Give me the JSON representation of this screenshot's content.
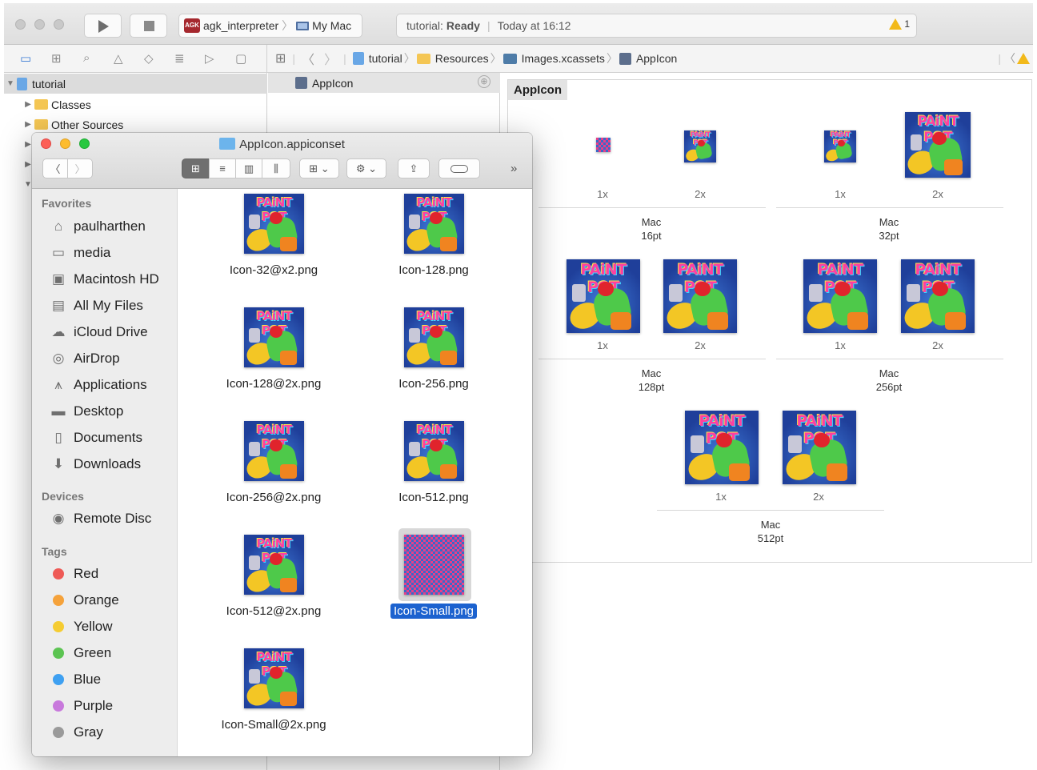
{
  "xcode": {
    "scheme": {
      "badge": "AGK",
      "target": "agk_interpreter",
      "device": "My Mac"
    },
    "activity": {
      "project": "tutorial:",
      "status": "Ready",
      "time": "Today at 16:12",
      "warnings": "1"
    },
    "jumpbar": [
      "tutorial",
      "Resources",
      "Images.xcassets",
      "AppIcon"
    ],
    "navigator": {
      "project": "tutorial",
      "items": [
        "Classes",
        "Other Sources"
      ]
    },
    "asset_list": {
      "selected": "AppIcon"
    },
    "catalog": {
      "title": "AppIcon",
      "groups": [
        {
          "name": "Mac",
          "size": "16pt",
          "slots": [
            "1x",
            "2x"
          ]
        },
        {
          "name": "Mac",
          "size": "32pt",
          "slots": [
            "1x",
            "2x"
          ]
        },
        {
          "name": "Mac",
          "size": "128pt",
          "slots": [
            "1x",
            "2x"
          ]
        },
        {
          "name": "Mac",
          "size": "256pt",
          "slots": [
            "1x",
            "2x"
          ]
        },
        {
          "name": "Mac",
          "size": "512pt",
          "slots": [
            "1x",
            "2x"
          ]
        }
      ],
      "icon_text": "PAiNT POT"
    }
  },
  "finder": {
    "title": "AppIcon.appiconset",
    "overflow": "»",
    "sidebar": {
      "favorites_header": "Favorites",
      "favorites": [
        {
          "label": "paulharthen",
          "icon": "home-icon"
        },
        {
          "label": "media",
          "icon": "folder-icon"
        },
        {
          "label": "Macintosh HD",
          "icon": "disk-icon"
        },
        {
          "label": "All My Files",
          "icon": "all-files-icon"
        },
        {
          "label": "iCloud Drive",
          "icon": "cloud-icon"
        },
        {
          "label": "AirDrop",
          "icon": "airdrop-icon"
        },
        {
          "label": "Applications",
          "icon": "applications-icon"
        },
        {
          "label": "Desktop",
          "icon": "desktop-icon"
        },
        {
          "label": "Documents",
          "icon": "documents-icon"
        },
        {
          "label": "Downloads",
          "icon": "downloads-icon"
        }
      ],
      "devices_header": "Devices",
      "devices": [
        {
          "label": "Remote Disc",
          "icon": "disc-icon"
        }
      ],
      "tags_header": "Tags",
      "tags": [
        {
          "label": "Red",
          "color": "#ee5a56"
        },
        {
          "label": "Orange",
          "color": "#f5a23b"
        },
        {
          "label": "Yellow",
          "color": "#f5cc32"
        },
        {
          "label": "Green",
          "color": "#5cc452"
        },
        {
          "label": "Blue",
          "color": "#3ea0f1"
        },
        {
          "label": "Purple",
          "color": "#c879dc"
        },
        {
          "label": "Gray",
          "color": "#9a9a9a"
        }
      ]
    },
    "files": [
      "Icon-32@x2.png",
      "Icon-128.png",
      "Icon-128@2x.png",
      "Icon-256.png",
      "Icon-256@2x.png",
      "Icon-512.png",
      "Icon-512@2x.png",
      "Icon-Small.png",
      "Icon-Small@2x.png"
    ],
    "selected_file": "Icon-Small.png"
  }
}
